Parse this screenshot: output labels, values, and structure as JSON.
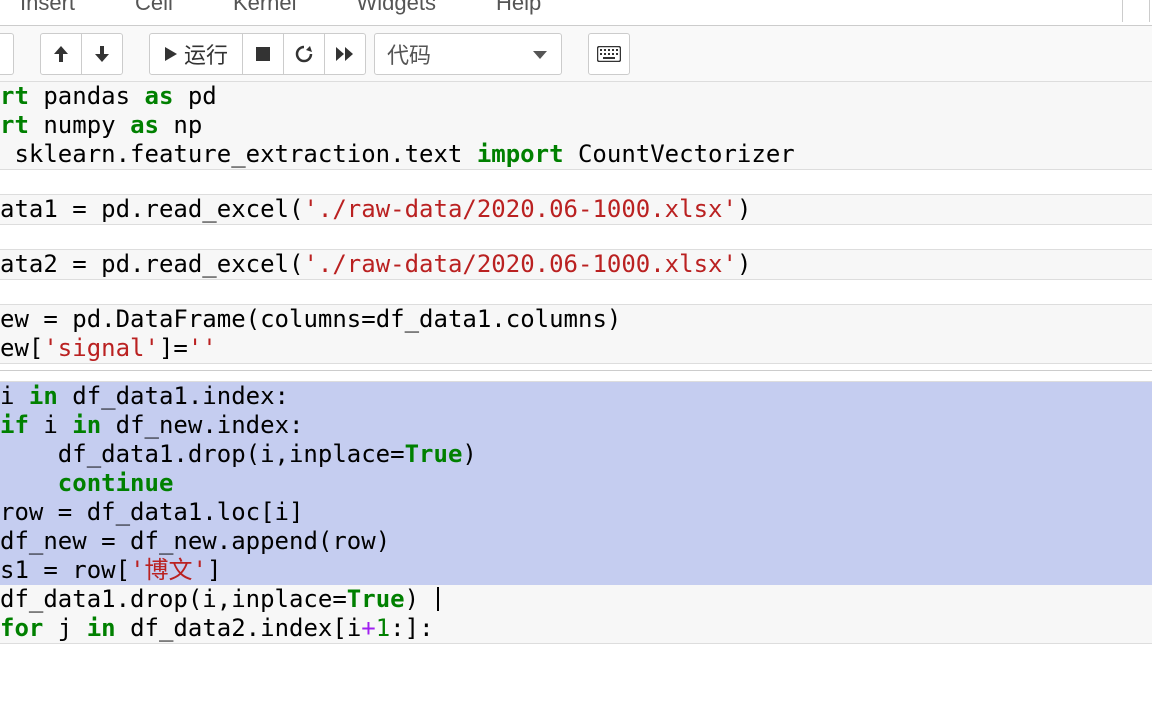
{
  "menubar": {
    "items": [
      "Insert",
      "Cell",
      "Kernel",
      "Widgets",
      "Help"
    ]
  },
  "toolbar": {
    "run_label": "运行",
    "cell_type": "代码"
  },
  "cells": [
    {
      "lines": [
        [
          {
            "t": "rt",
            "c": "kw-green"
          },
          {
            "t": " pandas "
          },
          {
            "t": "as",
            "c": "kw-green"
          },
          {
            "t": " pd"
          }
        ],
        [
          {
            "t": "rt",
            "c": "kw-green"
          },
          {
            "t": " numpy "
          },
          {
            "t": "as",
            "c": "kw-green"
          },
          {
            "t": " np"
          }
        ],
        [
          {
            "t": " sklearn.feature_extraction.text "
          },
          {
            "t": "import",
            "c": "kw-green"
          },
          {
            "t": " CountVectorizer"
          }
        ]
      ]
    },
    {
      "lines": [
        [
          {
            "t": "ata1 "
          },
          {
            "t": "="
          },
          {
            "t": " pd.read_excel("
          },
          {
            "t": "'./raw-data/2020.06-1000.xlsx'",
            "c": "str"
          },
          {
            "t": ")"
          }
        ]
      ]
    },
    {
      "lines": [
        [
          {
            "t": "ata2 "
          },
          {
            "t": "="
          },
          {
            "t": " pd.read_excel("
          },
          {
            "t": "'./raw-data/2020.06-1000.xlsx'",
            "c": "str"
          },
          {
            "t": ")"
          }
        ]
      ]
    },
    {
      "lines": [
        [
          {
            "t": "ew "
          },
          {
            "t": "="
          },
          {
            "t": " pd.DataFrame(columns"
          },
          {
            "t": "="
          },
          {
            "t": "df_data1.columns)"
          }
        ],
        [
          {
            "t": "ew["
          },
          {
            "t": "'signal'",
            "c": "str"
          },
          {
            "t": "]"
          },
          {
            "t": "="
          },
          {
            "t": "''",
            "c": "str"
          }
        ]
      ]
    },
    {
      "selected_rows": 7,
      "caret_after_row": 7,
      "lines": [
        [
          {
            "t": "i "
          },
          {
            "t": "in",
            "c": "kw-green"
          },
          {
            "t": " df_data1.index:"
          }
        ],
        [
          {
            "t": "if",
            "c": "kw-green"
          },
          {
            "t": " i "
          },
          {
            "t": "in",
            "c": "kw-green"
          },
          {
            "t": " df_new.index:"
          }
        ],
        [
          {
            "t": "    df_data1.drop(i,inplace"
          },
          {
            "t": "="
          },
          {
            "t": "True",
            "c": "bool"
          },
          {
            "t": ")"
          }
        ],
        [
          {
            "t": "    "
          },
          {
            "t": "continue",
            "c": "kw-green"
          }
        ],
        [
          {
            "t": "row "
          },
          {
            "t": "="
          },
          {
            "t": " df_data1.loc[i]"
          }
        ],
        [
          {
            "t": "df_new "
          },
          {
            "t": "="
          },
          {
            "t": " df_new.append(row)"
          }
        ],
        [
          {
            "t": "s1 "
          },
          {
            "t": "="
          },
          {
            "t": " row["
          },
          {
            "t": "'博文'",
            "c": "str"
          },
          {
            "t": "]"
          }
        ],
        [
          {
            "t": "df_data1.drop(i,inplace"
          },
          {
            "t": "="
          },
          {
            "t": "True",
            "c": "bool"
          },
          {
            "t": ")"
          },
          {
            "caret": true
          }
        ],
        [
          {
            "t": "for",
            "c": "kw-green"
          },
          {
            "t": " j "
          },
          {
            "t": "in",
            "c": "kw-green"
          },
          {
            "t": " df_data2.index[i"
          },
          {
            "t": "+",
            "c": "op"
          },
          {
            "t": "1",
            "c": "kw-green-nb"
          },
          {
            "t": ":]:"
          }
        ]
      ]
    }
  ]
}
